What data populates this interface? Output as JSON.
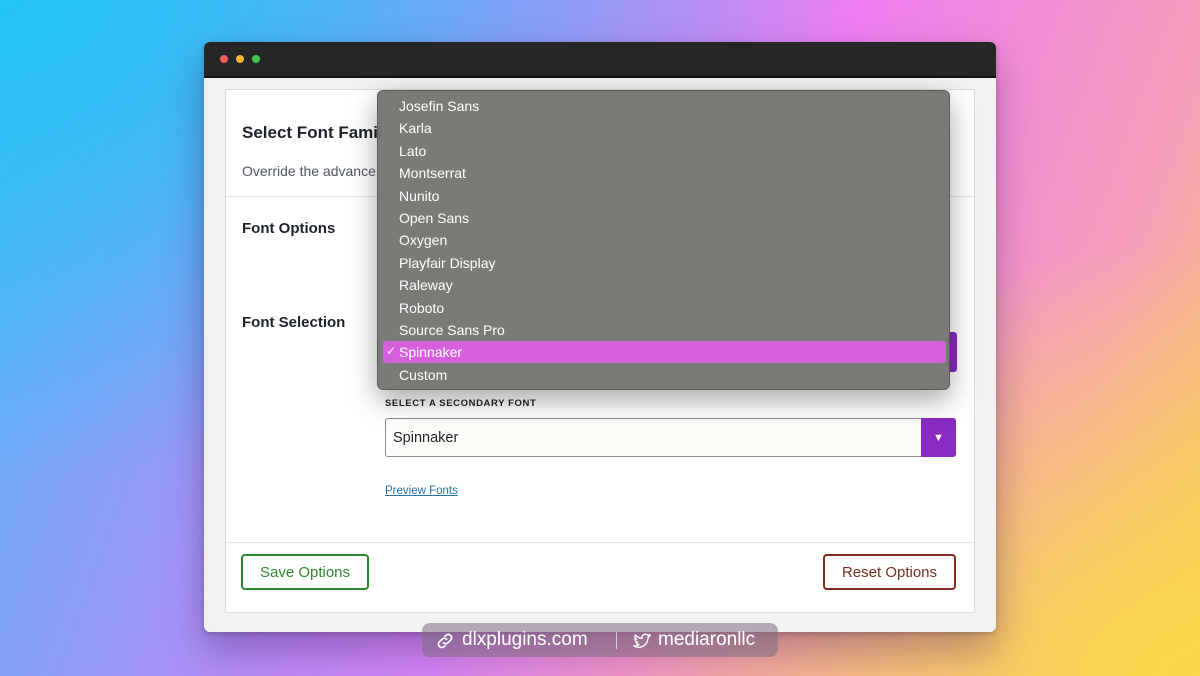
{
  "panel": {
    "title": "Select Font Famil",
    "description": "Override the advance"
  },
  "rows": {
    "font_options": "Font Options",
    "font_selection": "Font Selection"
  },
  "secondary": {
    "label": "SELECT A SECONDARY FONT",
    "value": "Spinnaker",
    "arrow": "▼"
  },
  "preview_link": "Preview Fonts",
  "buttons": {
    "save": "Save Options",
    "reset": "Reset Options"
  },
  "dropdown": {
    "check": "✓",
    "selected_index": 11,
    "items": [
      "Josefin Sans",
      "Karla",
      "Lato",
      "Montserrat",
      "Nunito",
      "Open Sans",
      "Oxygen",
      "Playfair Display",
      "Raleway",
      "Roboto",
      "Source Sans Pro",
      "Spinnaker",
      "Custom"
    ]
  },
  "footer": {
    "site": "dlxplugins.com",
    "handle": "mediaronllc"
  },
  "colors": {
    "accent_purple": "#8a2bc2",
    "selected_highlight": "#d65fdb",
    "save_green": "#2e8a30",
    "reset_brown": "#7e2d1b",
    "link_blue": "#2271b1"
  }
}
